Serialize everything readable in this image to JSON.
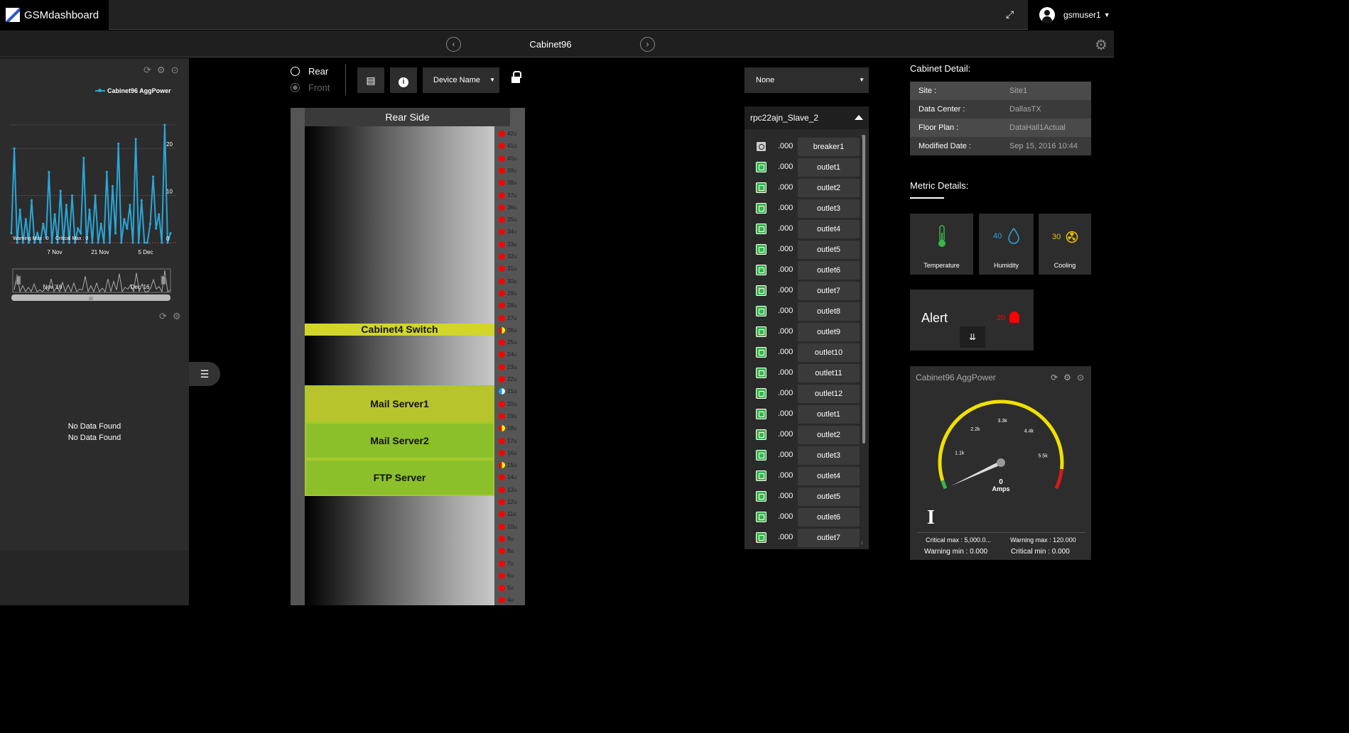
{
  "app": {
    "logo_text": "GSMdashboard",
    "user_name": "gsmuser1"
  },
  "header": {
    "cabinet_title": "Cabinet96"
  },
  "left_panel": {
    "legend": "Cabinet96 AggPower",
    "chart_markers": [
      "Warning Max : 0",
      "Critical Max : 0"
    ],
    "no_data_1": "No Data Found",
    "no_data_2": "No Data Found"
  },
  "chart_data": {
    "type": "line",
    "title": "",
    "series": [
      {
        "name": "Cabinet96 AggPower",
        "values": [
          2,
          20,
          0,
          7,
          0,
          5,
          0,
          9,
          0,
          2,
          0,
          4,
          1,
          15,
          0,
          6,
          0,
          11,
          0,
          8,
          0,
          10,
          0,
          3,
          2,
          18,
          0,
          7,
          0,
          10,
          0,
          4,
          0,
          15,
          0,
          12,
          2,
          21,
          0,
          5,
          3,
          8,
          0,
          22,
          0,
          9,
          0,
          0,
          4,
          14,
          3,
          6,
          0,
          25,
          0,
          2
        ]
      }
    ],
    "x_tick_labels": [
      "7 Nov",
      "21 Nov",
      "5 Dec"
    ],
    "y_tick_labels": [
      "20",
      "10",
      "0"
    ],
    "ylim": [
      0,
      25
    ],
    "navigator_labels": [
      "Nov '16",
      "Dec '16"
    ],
    "navigator_handle": "III"
  },
  "rack_controls": {
    "rear_label": "Rear",
    "front_label": "Front",
    "device_select": "Device Name"
  },
  "rack": {
    "head": "Rear Side",
    "units": [
      "42u",
      "41u",
      "40u",
      "39u",
      "38u",
      "37u",
      "36u",
      "35u",
      "34u",
      "33u",
      "32u",
      "31u",
      "30u",
      "29u",
      "28u",
      "27u",
      "26u",
      "25u",
      "24u",
      "23u",
      "22u",
      "21u",
      "20u",
      "19u",
      "18u",
      "17u",
      "16u",
      "15u",
      "14u",
      "13u",
      "12u",
      "11u",
      "10u",
      "9u",
      "8u",
      "7u",
      "6u",
      "5u",
      "4u"
    ],
    "devices": {
      "switch": "Cabinet4 Switch",
      "mail1": "Mail Server1",
      "mail2": "Mail Server2",
      "ftp": "FTP Server"
    }
  },
  "pdu": {
    "select": "None",
    "head": "rpc22ajn_Slave_2",
    "outlets": [
      {
        "val": ".000",
        "name": "breaker1"
      },
      {
        "val": ".000",
        "name": "outlet1"
      },
      {
        "val": ".000",
        "name": "outlet2"
      },
      {
        "val": ".000",
        "name": "outlet3"
      },
      {
        "val": ".000",
        "name": "outlet4"
      },
      {
        "val": ".000",
        "name": "outlet5"
      },
      {
        "val": ".000",
        "name": "outlet6"
      },
      {
        "val": ".000",
        "name": "outlet7"
      },
      {
        "val": ".000",
        "name": "outlet8"
      },
      {
        "val": ".000",
        "name": "outlet9"
      },
      {
        "val": ".000",
        "name": "outlet10"
      },
      {
        "val": ".000",
        "name": "outlet11"
      },
      {
        "val": ".000",
        "name": "outlet12"
      },
      {
        "val": ".000",
        "name": "outlet1"
      },
      {
        "val": ".000",
        "name": "outlet2"
      },
      {
        "val": ".000",
        "name": "outlet3"
      },
      {
        "val": ".000",
        "name": "outlet4"
      },
      {
        "val": ".000",
        "name": "outlet5"
      },
      {
        "val": ".000",
        "name": "outlet6"
      },
      {
        "val": ".000",
        "name": "outlet7"
      }
    ]
  },
  "cabinet_detail": {
    "title": "Cabinet Detail:",
    "rows": [
      {
        "key": "Site :",
        "value": "Site1"
      },
      {
        "key": "Data Center :",
        "value": "DallasTX"
      },
      {
        "key": "Floor Plan :",
        "value": "DataHall1Actual"
      },
      {
        "key": "Modified Date :",
        "value": "Sep 15, 2016 10:44"
      }
    ]
  },
  "metric_details": {
    "title": "Metric Details:",
    "temperature_label": "Temperature",
    "humidity_value": "40",
    "humidity_label": "Humidity",
    "cooling_value": "30",
    "cooling_label": "Cooling"
  },
  "alert": {
    "title": "Alert",
    "count": "20"
  },
  "gauge": {
    "title": "Cabinet96 AggPower",
    "ticks": [
      "1.1k",
      "2.2k",
      "3.3k",
      "4.4k",
      "5.5k"
    ],
    "value": "0",
    "unit": "Amps",
    "critical_max": "Critical max : 5,000.0...",
    "warning_max": "Warning max : 120.000",
    "warning_min": "Warning min : 0.000",
    "critical_min": "Critical min : 0.000"
  },
  "colors": {
    "accent_line": "#2aa6d8",
    "outlet_green": "#39b54a",
    "alert_red": "#ff0000",
    "gauge_yellow": "#f0e000"
  }
}
